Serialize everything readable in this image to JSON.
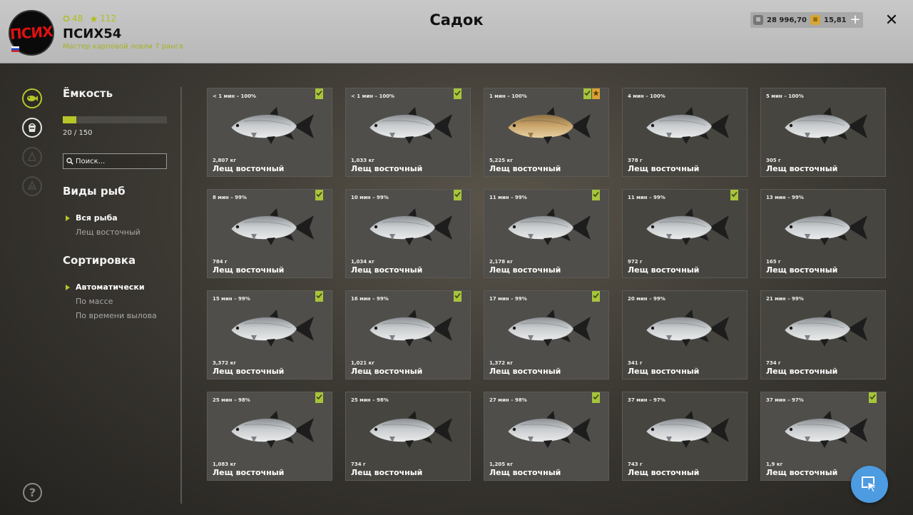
{
  "header": {
    "title": "Садок",
    "player": {
      "name": "ПСИХ54",
      "rank": "Мастер карповой ловли 7 ранга",
      "avatar_text": "ПСИХ",
      "level": "48",
      "stars": "112"
    },
    "silver": "28 996,70",
    "gold": "15,81",
    "plus_label": "+",
    "close_label": "✕"
  },
  "sidebar": {
    "capacity_title": "Ёмкость",
    "capacity_text": "20 / 150",
    "capacity_fraction": 0.133,
    "search_placeholder": "Поиск...",
    "species_title": "Виды рыб",
    "species": [
      {
        "label": "Вся рыба",
        "active": true
      },
      {
        "label": "Лещ восточный",
        "active": false
      }
    ],
    "sort_title": "Сортировка",
    "sort_options": [
      {
        "label": "Автоматически",
        "active": true
      },
      {
        "label": "По массе",
        "active": false
      },
      {
        "label": "По времени вылова",
        "active": false
      }
    ],
    "help_label": "?"
  },
  "fish": [
    {
      "time": "< 1 мин – 100%",
      "weight": "2,807 кг",
      "name": "Лещ восточный",
      "badges": [
        "green"
      ],
      "golden": false,
      "released": false
    },
    {
      "time": "< 1 мин – 100%",
      "weight": "1,033 кг",
      "name": "Лещ восточный",
      "badges": [
        "green"
      ],
      "golden": false,
      "released": false
    },
    {
      "time": "1 мин – 100%",
      "weight": "5,225 кг",
      "name": "Лещ восточный",
      "badges": [
        "green",
        "gold"
      ],
      "golden": true,
      "released": false
    },
    {
      "time": "4 мин – 100%",
      "weight": "378 г",
      "name": "Лещ восточный",
      "badges": [],
      "golden": false,
      "released": true
    },
    {
      "time": "5 мин – 100%",
      "weight": "305 г",
      "name": "Лещ восточный",
      "badges": [],
      "golden": false,
      "released": true
    },
    {
      "time": "8 мин – 99%",
      "weight": "784 г",
      "name": "Лещ восточный",
      "badges": [
        "green"
      ],
      "golden": false,
      "released": false
    },
    {
      "time": "10 мин – 99%",
      "weight": "1,034 кг",
      "name": "Лещ восточный",
      "badges": [
        "green"
      ],
      "golden": false,
      "released": false
    },
    {
      "time": "11 мин – 99%",
      "weight": "2,178 кг",
      "name": "Лещ восточный",
      "badges": [
        "green"
      ],
      "golden": false,
      "released": false
    },
    {
      "time": "11 мин – 99%",
      "weight": "972 г",
      "name": "Лещ восточный",
      "badges": [
        "green"
      ],
      "golden": false,
      "released": true
    },
    {
      "time": "13 мин – 99%",
      "weight": "165 г",
      "name": "Лещ восточный",
      "badges": [],
      "golden": false,
      "released": true
    },
    {
      "time": "15 мин – 99%",
      "weight": "3,372 кг",
      "name": "Лещ восточный",
      "badges": [
        "green"
      ],
      "golden": false,
      "released": false
    },
    {
      "time": "16 мин – 99%",
      "weight": "1,021 кг",
      "name": "Лещ восточный",
      "badges": [
        "green"
      ],
      "golden": false,
      "released": false
    },
    {
      "time": "17 мин – 99%",
      "weight": "1,372 кг",
      "name": "Лещ восточный",
      "badges": [
        "green"
      ],
      "golden": false,
      "released": false
    },
    {
      "time": "20 мин – 99%",
      "weight": "341 г",
      "name": "Лещ восточный",
      "badges": [],
      "golden": false,
      "released": true
    },
    {
      "time": "21 мин – 99%",
      "weight": "734 г",
      "name": "Лещ восточный",
      "badges": [],
      "golden": false,
      "released": true
    },
    {
      "time": "25 мин – 98%",
      "weight": "1,083 кг",
      "name": "Лещ восточный",
      "badges": [
        "green"
      ],
      "golden": false,
      "released": false
    },
    {
      "time": "25 мин – 98%",
      "weight": "734 г",
      "name": "Лещ восточный",
      "badges": [],
      "golden": false,
      "released": true
    },
    {
      "time": "27 мин – 98%",
      "weight": "1,205 кг",
      "name": "Лещ восточный",
      "badges": [
        "green"
      ],
      "golden": false,
      "released": false
    },
    {
      "time": "37 мин – 97%",
      "weight": "743 г",
      "name": "Лещ восточный",
      "badges": [],
      "golden": false,
      "released": true
    },
    {
      "time": "37 мин – 97%",
      "weight": "1,9 кг",
      "name": "Лещ восточный",
      "badges": [
        "green"
      ],
      "golden": false,
      "released": false
    }
  ],
  "colors": {
    "accent": "#b6c629",
    "badge_green": "#a7c43b",
    "badge_gold": "#d9a334",
    "cursor_button": "#4d9be0"
  },
  "icons": {
    "rail": [
      "fish-keepnet-icon",
      "bait-bucket-icon",
      "tackle-icon",
      "boat-icon"
    ],
    "search": "search-icon",
    "cursor": "cursor-mode-icon"
  }
}
